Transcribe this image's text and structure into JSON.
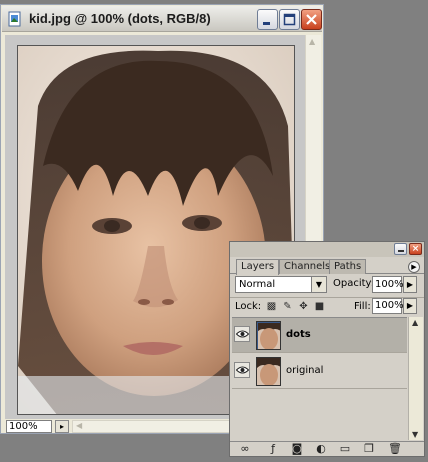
{
  "document": {
    "title": "kid.jpg @ 100% (dots, RGB/8)",
    "zoom": "100%",
    "icons": [
      "photoshop-document-icon",
      "minimize-icon",
      "maximize-icon",
      "close-icon"
    ]
  },
  "layers_panel": {
    "tabs": [
      "Layers",
      "Channels",
      "Paths"
    ],
    "active_tab": "Layers",
    "blend_mode": "Normal",
    "opacity_label": "Opacity:",
    "opacity_value": "100%",
    "lock_label": "Lock:",
    "fill_label": "Fill:",
    "fill_value": "100%",
    "layers": [
      {
        "name": "dots",
        "visible": true,
        "selected": true
      },
      {
        "name": "original",
        "visible": true,
        "selected": false
      }
    ],
    "footer_icons": [
      "link-layers-icon",
      "layer-style-icon",
      "layer-mask-icon",
      "adjustment-layer-icon",
      "group-folder-icon",
      "new-layer-icon",
      "trash-icon"
    ]
  },
  "colors": {
    "window_frame": "#ece9d8",
    "canvas_bg": "#c7c7c7",
    "desktop": "#808080",
    "selected_layer": "#b3b0a8",
    "close_button": "#c9411e"
  }
}
